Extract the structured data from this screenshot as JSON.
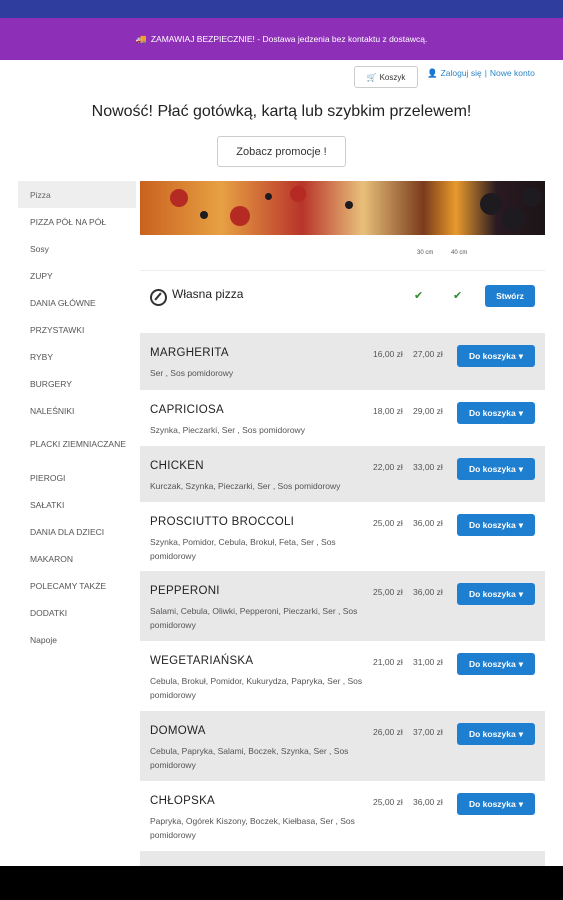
{
  "banner": {
    "truck_icon": "truck-icon",
    "text": "ZAMAWIAJ BEZPIECZNIE! - Dostawa jedzenia bez kontaktu z dostawcą."
  },
  "account": {
    "cart_label": "Koszyk",
    "login_label": "Zaloguj się",
    "separator": "|",
    "register_label": "Nowe konto"
  },
  "headline": "Nowość! Płać gotówką, kartą lub szybkim przelewem!",
  "promo_button": "Zobacz promocje !",
  "categories": [
    "Pizza",
    "PIZZA PÓŁ NA PÓŁ",
    "Sosy",
    "ZUPY",
    "DANIA GŁÓWNE",
    "PRZYSTAWKI",
    "RYBY",
    "BURGERY",
    "NALEŚNIKI",
    "PLACKI ZIEMNIACZANE",
    "PIEROGI",
    "SAŁATKI",
    "DANIA DLA DZIECI",
    "MAKARON",
    "POLECAMY TAKŻE",
    "DODATKI",
    "Napoje"
  ],
  "sizes": {
    "small": "30 cm",
    "large": "40 cm"
  },
  "custom_pizza": {
    "label": "Własna pizza",
    "check": "✔",
    "button": "Stwórz"
  },
  "add_label": "Do koszyka",
  "items": [
    {
      "name": "MARGHERITA",
      "ingredients": "Ser , Sos pomidorowy",
      "price_small": "16,00 zł",
      "price_large": "27,00 zł"
    },
    {
      "name": "CAPRICIOSA",
      "ingredients": "Szynka, Pieczarki, Ser , Sos pomidorowy",
      "price_small": "18,00 zł",
      "price_large": "29,00 zł"
    },
    {
      "name": "CHICKEN",
      "ingredients": "Kurczak, Szynka, Pieczarki, Ser , Sos pomidorowy",
      "price_small": "22,00 zł",
      "price_large": "33,00 zł"
    },
    {
      "name": "PROSCIUTTO BROCCOLI",
      "ingredients": "Szynka, Pomidor, Cebula, Brokuł, Feta, Ser , Sos pomidorowy",
      "price_small": "25,00 zł",
      "price_large": "36,00 zł"
    },
    {
      "name": "PEPPERONI",
      "ingredients": "Salami, Cebula, Oliwki, Pepperoni, Pieczarki, Ser , Sos pomidorowy",
      "price_small": "25,00 zł",
      "price_large": "36,00 zł"
    },
    {
      "name": "WEGETARIAŃSKA",
      "ingredients": "Cebula, Brokuł, Pomidor, Kukurydza, Papryka, Ser , Sos pomidorowy",
      "price_small": "21,00 zł",
      "price_large": "31,00 zł"
    },
    {
      "name": "DOMOWA",
      "ingredients": "Cebula, Papryka, Salami, Boczek, Szynka, Ser , Sos pomidorowy",
      "price_small": "26,00 zł",
      "price_large": "37,00 zł"
    },
    {
      "name": "CHŁOPSKA",
      "ingredients": "Papryka, Ogórek Kiszony, Boczek, Kiełbasa, Ser , Sos pomidorowy",
      "price_small": "25,00 zł",
      "price_large": "36,00 zł"
    }
  ],
  "colors": {
    "topbar": "#2f3e9e",
    "banner": "#8e2fb8",
    "button": "#1e7fd0"
  }
}
